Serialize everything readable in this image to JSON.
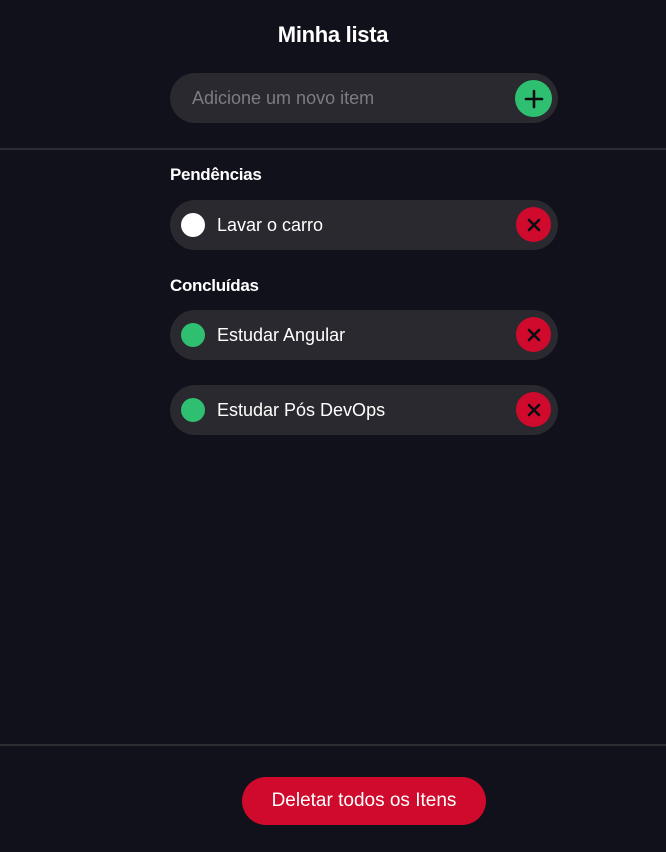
{
  "header": {
    "title": "Minha lista"
  },
  "add_item": {
    "placeholder": "Adicione um novo item",
    "value": "",
    "button_icon": "plus-icon"
  },
  "pending": {
    "title": "Pendências",
    "items": [
      {
        "label": "Lavar o carro",
        "done": false
      }
    ]
  },
  "completed": {
    "title": "Concluídas",
    "items": [
      {
        "label": "Estudar Angular",
        "done": true
      },
      {
        "label": "Estudar Pós DevOps",
        "done": true
      }
    ]
  },
  "footer": {
    "delete_all_label": "Deletar todos os Itens"
  },
  "colors": {
    "background": "#11111b",
    "surface": "#29292f",
    "accent_green": "#2fbf71",
    "danger_red": "#cf0a2c"
  }
}
